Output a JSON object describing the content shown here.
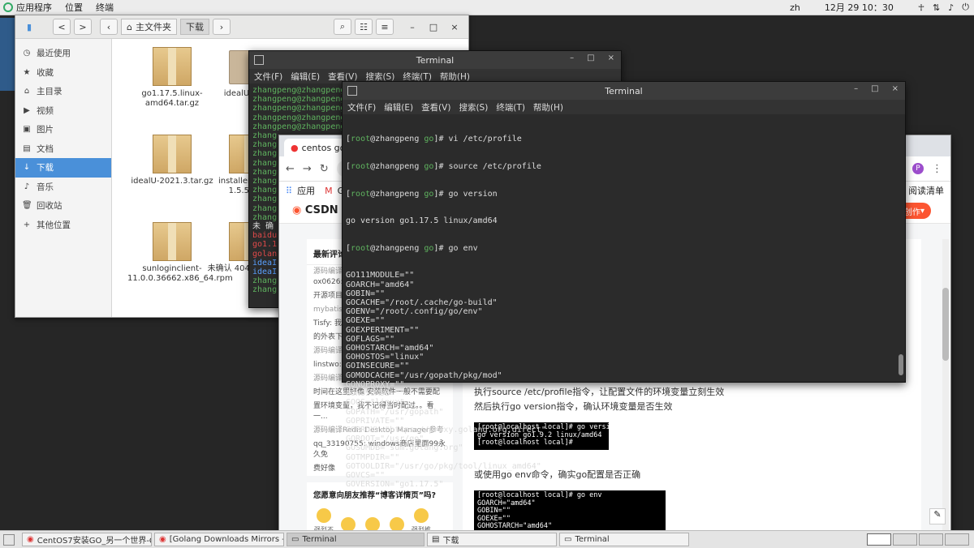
{
  "topbar": {
    "apps": "应用程序",
    "places": "位置",
    "terminal": "终端",
    "lang": "zh",
    "clock": "12月 29 10：30"
  },
  "files": {
    "back": "<",
    "forward": ">",
    "crumb_home": "主文件夹",
    "crumb_current": "下载",
    "sidebar": [
      {
        "label": "最近使用",
        "icon": "clock-icon"
      },
      {
        "label": "收藏",
        "icon": "star-icon"
      },
      {
        "label": "主目录",
        "icon": "home-icon"
      },
      {
        "label": "视频",
        "icon": "video-icon"
      },
      {
        "label": "图片",
        "icon": "image-icon"
      },
      {
        "label": "文档",
        "icon": "document-icon"
      },
      {
        "label": "下载",
        "icon": "download-icon"
      },
      {
        "label": "音乐",
        "icon": "music-icon"
      },
      {
        "label": "回收站",
        "icon": "trash-icon"
      },
      {
        "label": "其他位置",
        "icon": "plus-icon"
      }
    ],
    "items": [
      {
        "name": "go1.17.5.linux-amd64.tar.gz"
      },
      {
        "name": "idealU-2021"
      },
      {
        "name": "idealU-2021.3.tar.gz"
      },
      {
        "name": "installer_redha 1.5.5.rpm"
      },
      {
        "name": "sunloginclient-11.0.0.36662.x86_64.rpm"
      },
      {
        "name": "未确认 404 crdownlo"
      }
    ]
  },
  "term1": {
    "title": "Terminal",
    "menu": [
      "文件(F)",
      "编辑(E)",
      "查看(V)",
      "搜索(S)",
      "终端(T)",
      "帮助(H)"
    ],
    "lines": [
      "zhangpeng@zhangpeng",
      "zhangpeng@zhangpeng",
      "zhangpeng@zhangpeng",
      "zhangpeng@zhangpeng",
      "zhangpeng@zhangpeng",
      "zhang",
      "zhang",
      "zhang",
      "zhang",
      "zhang",
      "zhang",
      "zhang",
      "zhang",
      "zhang",
      "zhang",
      "未 确 认",
      "baidu",
      "go1.1",
      "golan",
      "ideaI",
      "ideaI",
      "zhang",
      "zhang"
    ]
  },
  "term2": {
    "title": "Terminal",
    "menu": [
      "文件(F)",
      "编辑(E)",
      "查看(V)",
      "搜索(S)",
      "终端(T)",
      "帮助(H)"
    ],
    "prompt_user": "root",
    "prompt_host": "zhangpeng",
    "prompt_dir": "go",
    "cmd1": "vi /etc/profile",
    "cmd2": "source /etc/profile",
    "cmd3": "go version",
    "out_version": "go version go1.17.5 linux/amd64",
    "cmd4": "go env",
    "env": [
      "GO111MODULE=\"\"",
      "GOARCH=\"amd64\"",
      "GOBIN=\"\"",
      "GOCACHE=\"/root/.cache/go-build\"",
      "GOENV=\"/root/.config/go/env\"",
      "GOEXE=\"\"",
      "GOEXPERIMENT=\"\"",
      "GOFLAGS=\"\"",
      "GOHOSTARCH=\"amd64\"",
      "GOHOSTOS=\"linux\"",
      "GOINSECURE=\"\"",
      "GOMODCACHE=\"/usr/gopath/pkg/mod\"",
      "GONOPROXY=\"\"",
      "GONOSUMDB=\"\"",
      "GOOS=\"linux\"",
      "GOPATH=\"/usr/gopath\"",
      "GOPRIVATE=\"\"",
      "GOPROXY=\"https://proxy.golang.org,direct\"",
      "GOROOT=\"/usr/go\"",
      "GOSUMDB=\"sum.golang.org\"",
      "GOTMPDIR=\"\"",
      "GOTOOLDIR=\"/usr/go/pkg/tool/linux_amd64\"",
      "GOVCS=\"\"",
      "GOVERSION=\"go1.17.5\""
    ]
  },
  "browser": {
    "tab_title": "centos go_",
    "bookmark_apps": "应用",
    "bookmark_gm": "Gm",
    "reading_list": "阅读清单",
    "profile_letter": "P",
    "csdn_logo": "CSDN",
    "write_btn": "创作",
    "recent_comments_title": "最新评论",
    "comments": [
      {
        "meta": "源码编译",
        "text": "ox0626:"
      },
      {
        "meta": "",
        "text": "开源项目"
      },
      {
        "meta": "mybatis-",
        "text": ""
      },
      {
        "meta": "",
        "text": "Tisfy: 我"
      },
      {
        "meta": "",
        "text": "的外表下"
      },
      {
        "meta": "源码编译",
        "text": ""
      },
      {
        "meta": "",
        "text": "linstwo: "
      },
      {
        "meta": "源码编译",
        "text": ""
      },
      {
        "meta": "",
        "text": "时间在这里好像 安装软件一般不需要配"
      },
      {
        "meta": "",
        "text": "置环境变量，我不记得当时配过。。看一..."
      },
      {
        "meta": "源码编译Redis Desktop Manager参考",
        "text": ""
      },
      {
        "meta": "",
        "text": "qq_33190755: windows商店里面99永久免"
      },
      {
        "meta": "",
        "text": "费好像"
      }
    ],
    "survey_title": "您愿意向朋友推荐“博客详情页”吗?",
    "survey_options": [
      "强烈不推荐",
      "不推荐",
      "一般般",
      "推荐",
      "强烈推荐"
    ],
    "article_p1": "执行source /etc/profile指令，让配置文件的环境变量立刻生效",
    "article_p2": "然后执行go version指令，确认环境变量是否生效",
    "code1": "[root@localhost local]# go version\ngo version go1.9.2 linux/amd64\n[root@localhost local]# ",
    "article_p3": "或使用go env命令，确实go配置是否正确",
    "code2": "[root@localhost local]# go env\nGOARCH=\"amd64\"\nGOBIN=\"\"\nGOEXE=\"\"\nGOHOSTARCH=\"amd64\""
  },
  "taskbar": {
    "items": [
      {
        "label": "CentOS7安装GO_另一个世界-CSD···",
        "icon": "chrome-icon",
        "active": false
      },
      {
        "label": "[Golang Downloads Mirrors - The G···",
        "icon": "chrome-icon",
        "active": false
      },
      {
        "label": "Terminal",
        "icon": "terminal-icon",
        "active": true
      },
      {
        "label": "下载",
        "icon": "files-icon",
        "active": false
      },
      {
        "label": "Terminal",
        "icon": "terminal-icon",
        "active": false
      }
    ]
  }
}
